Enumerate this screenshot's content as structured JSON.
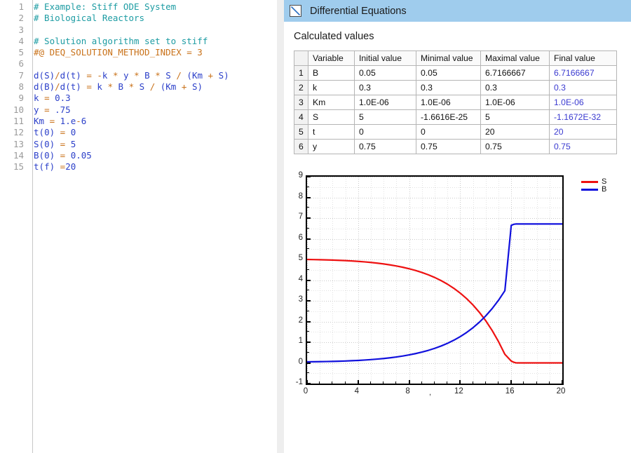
{
  "editor": {
    "line_numbers": [
      "1",
      "2",
      "3",
      "4",
      "5",
      "6",
      "7",
      "8",
      "9",
      "10",
      "11",
      "12",
      "13",
      "14",
      "15"
    ],
    "lines": [
      "# Example: Stiff ODE System",
      "# Biological Reactors",
      "",
      "# Solution algorithm set to stiff",
      "#@ DEQ_SOLUTION_METHOD_INDEX = 3",
      "",
      "d(S)/d(t) = -k * y * B * S / (Km + S)",
      "d(B)/d(t) = k * B * S / (Km + S)",
      "k = 0.3",
      "y = .75",
      "Km = 1.e-6",
      "t(0) = 0",
      "S(0) = 5",
      "B(0) = 0.05",
      "t(f) =20"
    ]
  },
  "results": {
    "header": {
      "title": "Differential Equations",
      "icon": "line-chart-icon"
    },
    "section_title": "Calculated values",
    "table": {
      "columns": [
        "",
        "Variable",
        "Initial value",
        "Minimal value",
        "Maximal value",
        "Final value"
      ],
      "rows": [
        {
          "index": "1",
          "variable": "B",
          "initial": "0.05",
          "minimal": "0.05",
          "maximal": "6.7166667",
          "final": "6.7166667"
        },
        {
          "index": "2",
          "variable": "k",
          "initial": "0.3",
          "minimal": "0.3",
          "maximal": "0.3",
          "final": "0.3"
        },
        {
          "index": "3",
          "variable": "Km",
          "initial": "1.0E-06",
          "minimal": "1.0E-06",
          "maximal": "1.0E-06",
          "final": "1.0E-06"
        },
        {
          "index": "4",
          "variable": "S",
          "initial": "5",
          "minimal": "-1.6616E-25",
          "maximal": "5",
          "final": "-1.1672E-32"
        },
        {
          "index": "5",
          "variable": "t",
          "initial": "0",
          "minimal": "0",
          "maximal": "20",
          "final": "20"
        },
        {
          "index": "6",
          "variable": "y",
          "initial": "0.75",
          "minimal": "0.75",
          "maximal": "0.75",
          "final": "0.75"
        }
      ]
    }
  },
  "chart_data": {
    "type": "line",
    "title": "",
    "xlabel": "",
    "ylabel": "",
    "xlim": [
      0,
      20
    ],
    "ylim": [
      -1,
      9
    ],
    "x_ticks": [
      0,
      4,
      8,
      12,
      16,
      20
    ],
    "y_ticks": [
      -1,
      0,
      1,
      2,
      3,
      4,
      5,
      6,
      7,
      8,
      9
    ],
    "x_minor_step": 1,
    "y_minor_step": 0.5,
    "grid": true,
    "legend_position": "right",
    "stray_marker": ",",
    "series": [
      {
        "name": "S",
        "color": "#ee1111",
        "x": [
          0,
          0.5,
          1,
          1.5,
          2,
          2.5,
          3,
          3.5,
          4,
          4.5,
          5,
          5.5,
          6,
          6.5,
          7,
          7.5,
          8,
          8.5,
          9,
          9.5,
          10,
          10.5,
          11,
          11.5,
          12,
          12.5,
          13,
          13.5,
          14,
          14.5,
          15,
          15.5,
          16,
          16.2,
          16.35,
          16.5,
          17,
          18,
          19,
          20
        ],
        "y": [
          5,
          4.994,
          4.988,
          4.98,
          4.97,
          4.958,
          4.944,
          4.927,
          4.907,
          4.883,
          4.855,
          4.822,
          4.783,
          4.738,
          4.685,
          4.623,
          4.551,
          4.468,
          4.371,
          4.259,
          4.129,
          3.979,
          3.805,
          3.605,
          3.374,
          3.107,
          2.8,
          2.446,
          2.039,
          1.57,
          1.031,
          0.414,
          0.09,
          0.03,
          0.005,
          0,
          0,
          0,
          0,
          0
        ]
      },
      {
        "name": "B",
        "color": "#1111dd",
        "x": [
          0,
          0.5,
          1,
          1.5,
          2,
          2.5,
          3,
          3.5,
          4,
          4.5,
          5,
          5.5,
          6,
          6.5,
          7,
          7.5,
          8,
          8.5,
          9,
          9.5,
          10,
          10.5,
          11,
          11.5,
          12,
          12.5,
          13,
          13.5,
          14,
          14.5,
          15,
          15.5,
          16,
          16.2,
          16.35,
          16.5,
          17,
          18,
          19,
          20
        ],
        "y": [
          0.05,
          0.0545,
          0.059,
          0.065,
          0.0725,
          0.0815,
          0.092,
          0.1048,
          0.1198,
          0.1378,
          0.1588,
          0.1835,
          0.2128,
          0.2465,
          0.2862,
          0.3328,
          0.3868,
          0.449,
          0.5218,
          0.6058,
          0.7033,
          0.8158,
          0.9463,
          1.0963,
          1.2695,
          1.4698,
          1.7,
          1.9655,
          2.2708,
          2.6225,
          3.0268,
          3.4895,
          6.65,
          6.7,
          6.715,
          6.7167,
          6.7167,
          6.7167,
          6.7167,
          6.7167
        ]
      }
    ]
  }
}
